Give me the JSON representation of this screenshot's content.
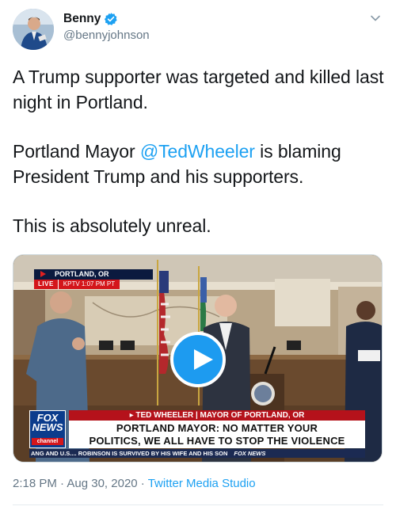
{
  "author": {
    "display_name": "Benny",
    "handle": "@bennyjohnson",
    "verified": true,
    "avatar_icon": "user-avatar"
  },
  "tweet": {
    "line1": "A Trump supporter was targeted and killed last night in Portland.",
    "para2_before": "Portland Mayor ",
    "para2_mention": "@TedWheeler",
    "para2_after": " is blaming President Trump and his supporters.",
    "line3": "This is absolutely unreal."
  },
  "media": {
    "type": "video",
    "location": "PORTLAND, OR",
    "live_label": "LIVE",
    "station_time": "KPTV    1:07 PM PT",
    "logo_fox": "FOX",
    "logo_news": "NEWS",
    "logo_channel": "channel",
    "name_strap": "▸ TED WHEELER | MAYOR OF PORTLAND, OR",
    "headline_line1": "PORTLAND MAYOR: NO MATTER YOUR",
    "headline_line2": "POLITICS, WE ALL HAVE TO STOP THE VIOLENCE",
    "ticker": "ANG AND U.S....  ROBINSON IS SURVIVED BY HIS WIFE AND HIS SON",
    "ticker_brand": "FOX NEWS",
    "play_icon": "play-icon"
  },
  "meta": {
    "time": "2:18 PM",
    "separator": " · ",
    "date": "Aug 30, 2020",
    "source": "Twitter Media Studio"
  },
  "colors": {
    "link": "#1da1f2",
    "text": "#14171a",
    "secondary": "#657786",
    "play": "#1d9bf0"
  }
}
